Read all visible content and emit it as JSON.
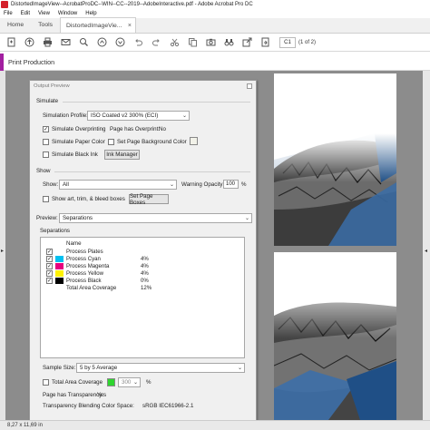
{
  "window": {
    "title": "DistortedImageView--AcrobatProDC--WIN--CC--2019--AdobeInteractive.pdf - Adobe Acrobat Pro DC"
  },
  "menubar": {
    "items": [
      "File",
      "Edit",
      "View",
      "Window",
      "Help"
    ]
  },
  "tabs": {
    "home": "Home",
    "tools": "Tools",
    "document": "DistortedImageVie...",
    "close": "×"
  },
  "toolbar": {
    "icons": [
      "create-pdf-icon",
      "upload-icon",
      "print-icon",
      "email-icon",
      "search-icon",
      "page-up-icon",
      "page-down-icon",
      "undo-icon",
      "redo-icon",
      "scissors-icon",
      "copy-icon",
      "camera-icon",
      "binoculars-icon",
      "export-icon",
      "export-pdf-icon"
    ],
    "page_current": "C1",
    "page_of": "(1 of 2)"
  },
  "tool_panel": {
    "title": "Print Production",
    "accent_color": "#a21fa0"
  },
  "dialog": {
    "title": "Output Preview",
    "simulate_section": "Simulate",
    "simulation_profile_label": "Simulation Profile:",
    "simulation_profile_value": "ISO Coated v2 300% (ECI)",
    "simulate_overprinting": "Simulate Overprinting",
    "page_has_overprint_label": "Page has Overprint:",
    "page_has_overprint_value": "No",
    "simulate_paper_color": "Simulate Paper Color",
    "set_page_background_color": "Set Page Background Color",
    "simulate_black_ink": "Simulate Black Ink",
    "ink_manager": "Ink Manager",
    "show_section": "Show",
    "show_label": "Show:",
    "show_value": "All",
    "warning_opacity_label": "Warning Opacity:",
    "warning_opacity_value": "100",
    "percent": "%",
    "show_art_trim": "Show art, trim, & bleed boxes",
    "set_page_boxes": "Set Page Boxes",
    "preview_label": "Preview:",
    "preview_value": "Separations",
    "separations_section": "Separations",
    "name_header": "Name",
    "separations": [
      {
        "name": "Process Plates",
        "pct": "",
        "color": ""
      },
      {
        "name": "Process Cyan",
        "pct": "4%",
        "color": "#00c0f0"
      },
      {
        "name": "Process Magenta",
        "pct": "4%",
        "color": "#e6007e"
      },
      {
        "name": "Process Yellow",
        "pct": "4%",
        "color": "#fff200"
      },
      {
        "name": "Process Black",
        "pct": "0%",
        "color": "#000000"
      },
      {
        "name": "Total Area Coverage",
        "pct": "12%",
        "color": ""
      }
    ],
    "sample_size_label": "Sample Size:",
    "sample_size_value": "5 by 5 Average",
    "total_area_coverage": "Total Area Coverage",
    "tac_value": "300",
    "tac_swatch_color": "#2fd52f",
    "page_has_transparency_label": "Page has Transparency:",
    "page_has_transparency_value": "Yes",
    "transparency_blending_label": "Transparency Blending Color Space:",
    "transparency_blending_value": "sRGB IEC61966-2.1"
  },
  "status": {
    "page_size": "8,27 x 11,69 in"
  }
}
